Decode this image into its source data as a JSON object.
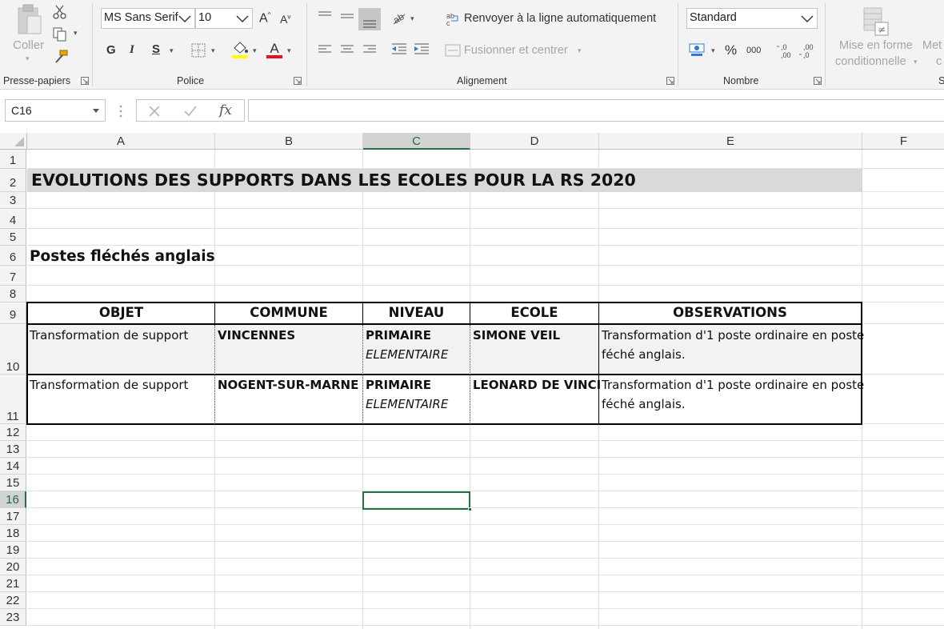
{
  "ribbon": {
    "clipboard": {
      "paste_label": "Coller",
      "group_label": "Presse-papiers"
    },
    "font": {
      "font_name": "MS Sans Serif",
      "font_size": "10",
      "bold_label": "G",
      "italic_label": "I",
      "underline_label": "S",
      "group_label": "Police",
      "fill_color": "#ffff00",
      "font_color": "#e81123"
    },
    "alignment": {
      "wrap_label": "Renvoyer à la ligne automatiquement",
      "merge_label": "Fusionner et centrer",
      "group_label": "Alignement"
    },
    "number": {
      "format": "Standard",
      "percent_label": "%",
      "thousands_label": "000",
      "inc_decimal_label": ",0 ,00",
      "group_label": "Nombre"
    },
    "styles": {
      "conditional_line1": "Mise en forme",
      "conditional_line2": "conditionnelle",
      "partial_line1": "Met",
      "partial_line2": "c",
      "partial_group": "S"
    }
  },
  "formula_bar": {
    "name_box": "C16",
    "fx_label": "fx",
    "formula": ""
  },
  "sheet": {
    "columns": [
      "A",
      "B",
      "C",
      "D",
      "E",
      "F"
    ],
    "rows": [
      "1",
      "2",
      "3",
      "4",
      "5",
      "6",
      "7",
      "8",
      "9",
      "10",
      "11",
      "12",
      "13",
      "14",
      "15",
      "16",
      "17",
      "18",
      "19",
      "20",
      "21",
      "22",
      "23"
    ],
    "selected_column": "C",
    "selected_row": "16",
    "title": "EVOLUTIONS DES SUPPORTS DANS LES ECOLES POUR LA RS 2020",
    "subtitle": "Postes fléchés anglais",
    "table": {
      "headers": [
        "OBJET",
        "COMMUNE",
        "NIVEAU",
        "ECOLE",
        "OBSERVATIONS"
      ],
      "rows": [
        {
          "objet": "Transformation de support",
          "commune": "VINCENNES",
          "niveau_line1": "PRIMAIRE",
          "niveau_line2": "ELEMENTAIRE",
          "ecole": "SIMONE VEIL",
          "observations_line1": "Transformation d'1 poste ordinaire en poste",
          "observations_line2": "féché anglais."
        },
        {
          "objet": "Transformation de support",
          "commune": "NOGENT-SUR-MARNE",
          "niveau_line1": "PRIMAIRE",
          "niveau_line2": "ELEMENTAIRE",
          "ecole": "LEONARD DE VINCI",
          "observations_line1": "Transformation d'1 poste ordinaire en poste",
          "observations_line2": "féché anglais."
        }
      ]
    }
  },
  "colors": {
    "excel_green": "#217346",
    "title_row_fill": "#d9d9d9",
    "row10_fill": "#f2f2f2"
  }
}
